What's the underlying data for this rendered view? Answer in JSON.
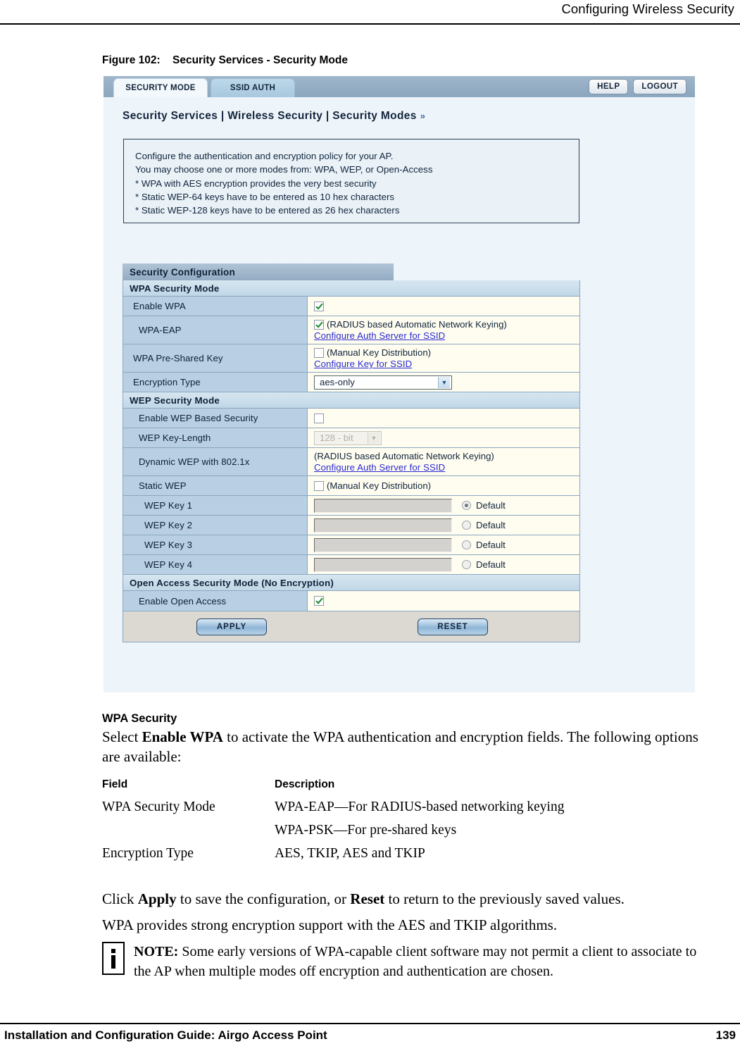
{
  "header": {
    "running_head": "Configuring Wireless Security"
  },
  "figure": {
    "number": "Figure 102:",
    "title": "Security Services - Security Mode"
  },
  "screenshot": {
    "tabs": [
      {
        "label": "SECURITY MODE",
        "selected": true
      },
      {
        "label": "SSID AUTH",
        "selected": false
      }
    ],
    "top_buttons": [
      {
        "label": "HELP"
      },
      {
        "label": "LOGOUT"
      }
    ],
    "breadcrumb": "Security Services | Wireless Security | Security Modes",
    "breadcrumb_chevron": "»",
    "info_lines": [
      "Configure the authentication and encryption policy for your AP.",
      "You may choose one or more modes from: WPA, WEP, or Open-Access",
      "* WPA with AES encryption provides the very best security",
      "* Static WEP-64 keys have to be entered as 10 hex characters",
      "* Static WEP-128 keys have to be entered as 26 hex characters"
    ],
    "config_title": "Security Configuration",
    "wpa_section_title": "WPA Security Mode",
    "wep_section_title": "WEP Security Mode",
    "open_section_title": "Open Access Security Mode (No Encryption)",
    "rows": {
      "enable_wpa": {
        "label": "Enable WPA",
        "checked": true
      },
      "wpa_eap": {
        "label": "WPA-EAP",
        "checked": true,
        "note": "(RADIUS based Automatic Network Keying)",
        "link": "Configure Auth Server for SSID"
      },
      "wpa_psk": {
        "label": "WPA Pre-Shared Key",
        "checked": false,
        "note": "(Manual Key Distribution)",
        "link": "Configure Key for SSID"
      },
      "encryption_type": {
        "label": "Encryption Type",
        "value": "aes-only"
      },
      "enable_wep": {
        "label": "Enable WEP Based Security",
        "checked": false
      },
      "wep_key_length": {
        "label": "WEP Key-Length",
        "value": "128 - bit",
        "disabled": true
      },
      "dynamic_wep": {
        "label": "Dynamic WEP with 802.1x",
        "note": "(RADIUS based Automatic Network Keying)",
        "link": "Configure Auth Server for SSID"
      },
      "static_wep": {
        "label": "Static WEP",
        "checked": false,
        "note": "(Manual Key Distribution)"
      },
      "wep_keys": [
        {
          "label": "WEP Key 1",
          "value": "",
          "default_label": "Default",
          "selected": true
        },
        {
          "label": "WEP Key 2",
          "value": "",
          "default_label": "Default",
          "selected": false
        },
        {
          "label": "WEP Key 3",
          "value": "",
          "default_label": "Default",
          "selected": false
        },
        {
          "label": "WEP Key 4",
          "value": "",
          "default_label": "Default",
          "selected": false
        }
      ],
      "enable_open_access": {
        "label": "Enable Open Access",
        "checked": true
      }
    },
    "buttons": {
      "apply": "APPLY",
      "reset": "RESET"
    }
  },
  "body": {
    "sub_head": "WPA Security",
    "intro_pre": "Select ",
    "intro_bold": "Enable WPA",
    "intro_post": " to activate the WPA authentication and encryption fields. The following options are available:",
    "table": {
      "headers": [
        "Field",
        "Description"
      ],
      "rows": [
        {
          "field": "WPA Security Mode",
          "description": [
            "WPA-EAP—For RADIUS-based networking keying",
            "WPA-PSK—For pre-shared keys"
          ]
        },
        {
          "field": "Encryption Type",
          "description": [
            "AES, TKIP, AES and TKIP"
          ]
        }
      ]
    },
    "click_pre": "Click ",
    "click_b1": "Apply",
    "click_mid": " to save the configuration, or ",
    "click_b2": "Reset",
    "click_post": " to return to the previously saved values.",
    "wpa_para": "WPA provides strong encryption support with the AES and TKIP algorithms.",
    "note_label": "NOTE:",
    "note_text": " Some early versions of WPA-capable client software may not permit a client to associate to the AP when multiple modes off encryption and authentication are chosen."
  },
  "footer": {
    "left": "Installation and Configuration Guide: Airgo Access Point",
    "page": "139"
  }
}
